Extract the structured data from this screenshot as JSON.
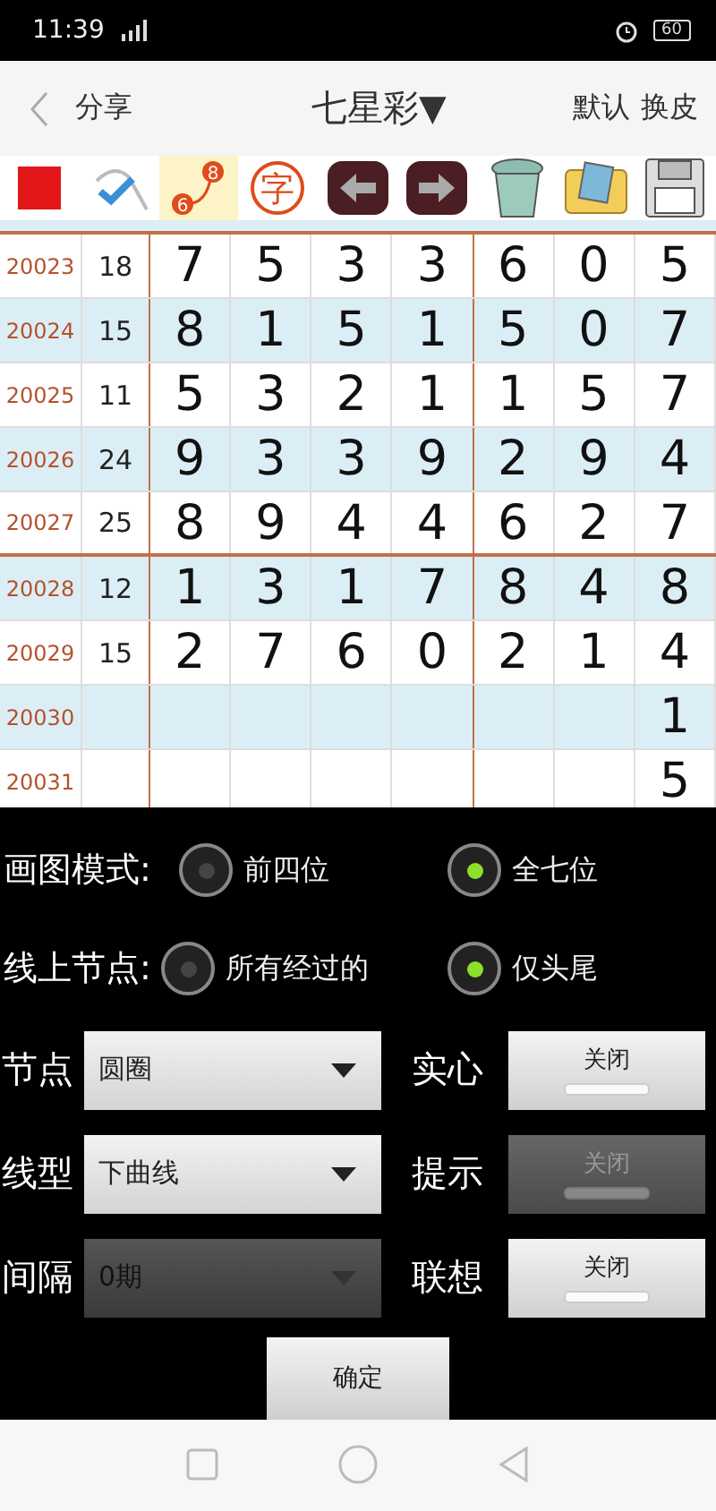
{
  "status_bar": {
    "time": "11:39",
    "battery": "60"
  },
  "header": {
    "back": "分享",
    "title": "七星彩▼",
    "actions": [
      "默认",
      "换皮"
    ]
  },
  "tools": [
    {
      "kind": "color",
      "selected": false
    },
    {
      "kind": "check",
      "selected": false
    },
    {
      "kind": "link",
      "selected": true,
      "from": "6",
      "to": "8"
    },
    {
      "kind": "char",
      "selected": false,
      "text": "字"
    },
    {
      "kind": "prev",
      "selected": false
    },
    {
      "kind": "next",
      "selected": false
    },
    {
      "kind": "trash",
      "selected": false
    },
    {
      "kind": "photos",
      "selected": false
    },
    {
      "kind": "save",
      "selected": false
    }
  ],
  "rows": [
    {
      "issue": "20023",
      "sum": "18",
      "digits": [
        "7",
        "5",
        "3",
        "3",
        "6",
        "0",
        "5"
      ]
    },
    {
      "issue": "20024",
      "sum": "15",
      "digits": [
        "8",
        "1",
        "5",
        "1",
        "5",
        "0",
        "7"
      ]
    },
    {
      "issue": "20025",
      "sum": "11",
      "digits": [
        "5",
        "3",
        "2",
        "1",
        "1",
        "5",
        "7"
      ]
    },
    {
      "issue": "20026",
      "sum": "24",
      "digits": [
        "9",
        "3",
        "3",
        "9",
        "2",
        "9",
        "4"
      ]
    },
    {
      "issue": "20027",
      "sum": "25",
      "digits": [
        "8",
        "9",
        "4",
        "4",
        "6",
        "2",
        "7"
      ]
    },
    {
      "issue": "20028",
      "sum": "12",
      "digits": [
        "1",
        "3",
        "1",
        "7",
        "8",
        "4",
        "8"
      ]
    },
    {
      "issue": "20029",
      "sum": "15",
      "digits": [
        "2",
        "7",
        "6",
        "0",
        "2",
        "1",
        "4"
      ]
    },
    {
      "issue": "20030",
      "digits": [
        "1"
      ]
    },
    {
      "issue": "20031",
      "digits": [
        "5"
      ]
    }
  ],
  "radio_groups": [
    {
      "label": "画图模式:",
      "options": [
        {
          "label": "前四位",
          "selected": false
        },
        {
          "label": "全七位",
          "selected": true
        }
      ]
    },
    {
      "label": "线上节点:",
      "options": [
        {
          "label": "所有经过的",
          "selected": false
        },
        {
          "label": "仅头尾",
          "selected": true
        }
      ]
    }
  ],
  "settings": [
    {
      "label": "节点",
      "value": "圆圈",
      "disabled": false,
      "toggle_label": "实心",
      "toggle_text": "关闭",
      "toggle_disabled": false
    },
    {
      "label": "线型",
      "value": "下曲线",
      "disabled": false,
      "toggle_label": "提示",
      "toggle_text": "关闭",
      "toggle_disabled": true
    },
    {
      "label": "间隔",
      "value": "0期",
      "disabled": true,
      "toggle_label": "联想",
      "toggle_text": "关闭",
      "toggle_disabled": false
    }
  ],
  "confirm": "确定"
}
